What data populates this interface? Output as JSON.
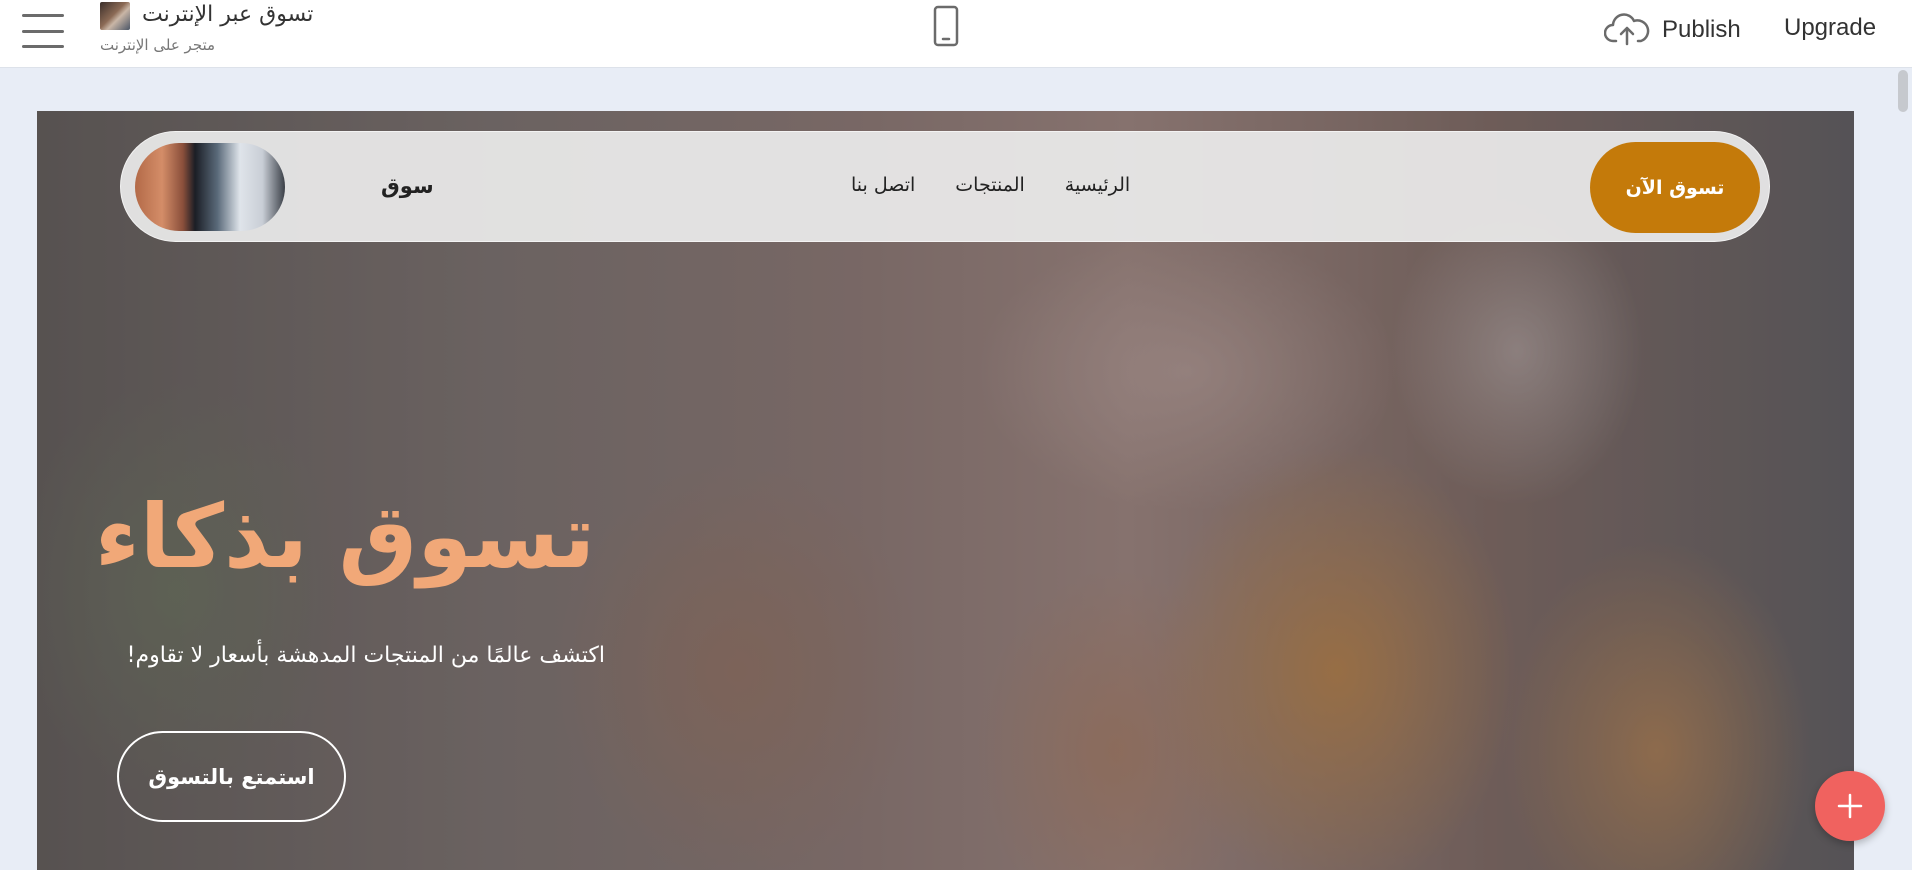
{
  "editor": {
    "site_title": "تسوق عبر الإنترنت",
    "site_subtitle": "متجر على الإنترنت",
    "publish_label": "Publish",
    "upgrade_label": "Upgrade",
    "icons": {
      "menu": "hamburger-menu-icon",
      "device": "mobile-phone-icon",
      "publish": "cloud-upload-icon",
      "add": "plus-icon"
    }
  },
  "site": {
    "nav": {
      "brand": "سوق",
      "links": [
        "الرئيسية",
        "المنتجات",
        "اتصل بنا"
      ],
      "cta": "تسوق الآن"
    },
    "hero": {
      "title": "تسوق بذكاء",
      "subtitle": "اكتشف عالمًا من المنتجات المدهشة بأسعار لا تقاوم!",
      "button": "استمتع بالتسوق"
    }
  },
  "colors": {
    "accent": "#c47a0a",
    "hero_title": "#f1a878",
    "fab": "#f0625f",
    "canvas_bg": "#e8edf6"
  }
}
